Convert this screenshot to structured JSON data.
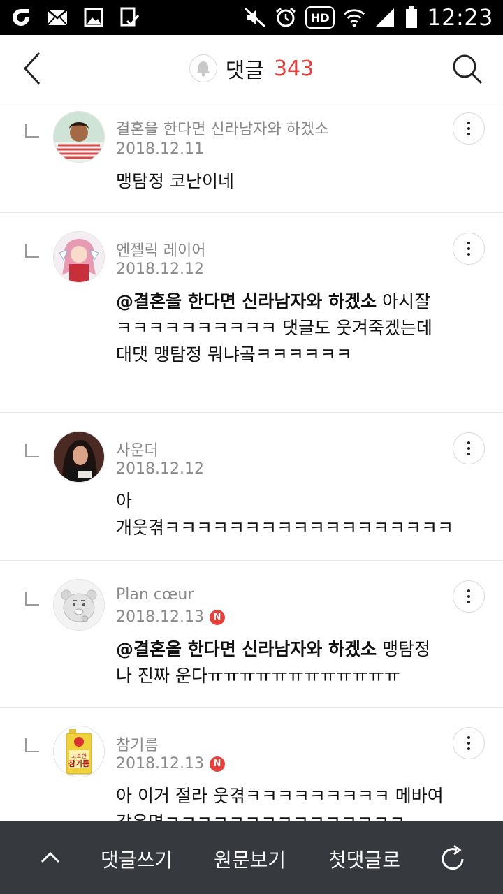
{
  "status_bar": {
    "time": "12:23",
    "hd_label": "HD",
    "left_icons": [
      "carrier-logo-icon",
      "mail-icon",
      "gallery-icon",
      "clipboard-icon"
    ],
    "right_icons": [
      "mute-icon",
      "alarm-icon",
      "hd-voice-icon",
      "wifi-icon",
      "signal-icon",
      "battery-icon"
    ]
  },
  "header": {
    "title": "댓글",
    "count": "343",
    "count_color": "#e5403c"
  },
  "comments": [
    {
      "author": "결혼을 한다면 신라남자와 하겠소",
      "date": "2018.12.11",
      "badge": "",
      "avatar": "avatar-man-striped-shirt",
      "mention": "",
      "text": "맹탐정 코난이네"
    },
    {
      "author": "엔젤릭 레이어",
      "date": "2018.12.12",
      "badge": "",
      "avatar": "avatar-anime-girl",
      "mention": "@결혼을 한다면 신라남자와 하겠소",
      "text": "아시잘ㅋㅋㅋㅋㅋㅋㅋㅋㅋㅋ 댓글도 웃겨죽겠는데 대댓 맹탐정 뭐냐곸ㅋㅋㅋㅋㅋㅋ"
    },
    {
      "author": "사운더",
      "date": "2018.12.12",
      "badge": "",
      "avatar": "avatar-woman-dark-hair",
      "mention": "",
      "text": "아\n개웃겪ㅋㅋㅋㅋㅋㅋㅋㅋㅋㅋㅋㅋㅋㅋㅋㅋㅋㅋ"
    },
    {
      "author": "Plan cœur",
      "date": "2018.12.13",
      "badge": "N",
      "avatar": "avatar-kakao-ryan",
      "mention": "@결혼을 한다면 신라남자와 하겠소",
      "text": "맹탐정 나 진짜 운다ㅠㅠㅠㅠㅠㅠㅠㅠㅠㅠㅠㅠ"
    },
    {
      "author": "참기름",
      "date": "2018.12.13",
      "badge": "N",
      "avatar": "avatar-sesame-oil-bottle",
      "mention": "",
      "text": "아 이거 절라 웃겪ㅋㅋㅋㅋㅋㅋㅋㅋㅋ 메바여 같은면ㅋㅋㅋㅋㅋㅋㅋㅋㅋㅋㅋㅋㅋㅋㅋ"
    }
  ],
  "bottom_bar": {
    "write_label": "댓글쓰기",
    "original_label": "원문보기",
    "first_label": "첫댓글로"
  },
  "avatar_labels": {
    "sesame_brand": "고소한",
    "sesame_name": "참기름"
  }
}
